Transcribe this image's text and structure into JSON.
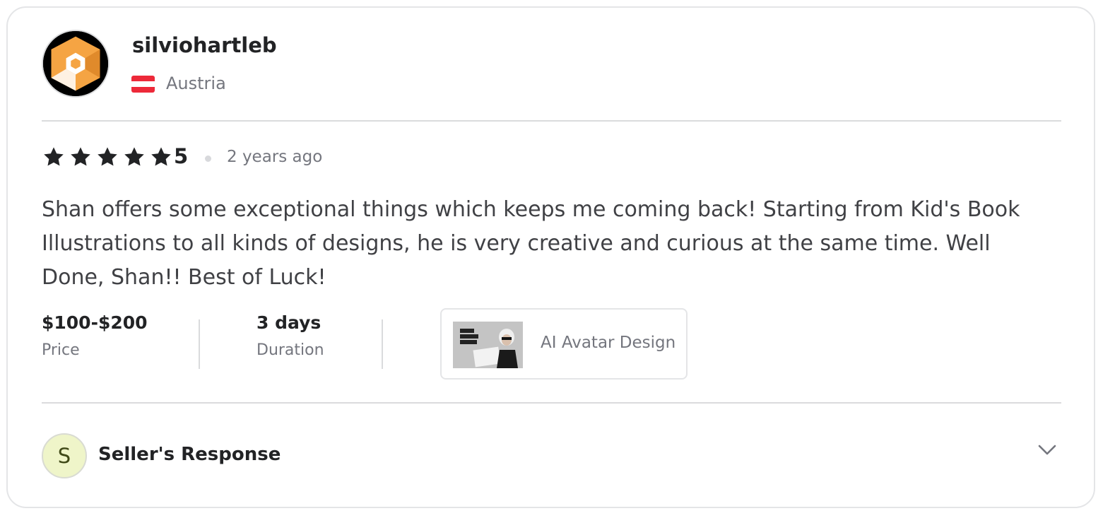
{
  "reviewer": {
    "username": "silviohartleb",
    "country": "Austria",
    "avatar_icon": "orange-hexagon-logo-icon",
    "flag_icon": "austria-flag-icon"
  },
  "review": {
    "rating": 5,
    "rating_label": "5",
    "time_ago": "2 years ago",
    "text": "Shan offers some exceptional things which keeps me coming back! Starting from Kid's Book Illustrations to all kinds of designs, he is very creative and curious at the same time. Well Done, Shan!! Best of Luck!"
  },
  "meta": {
    "price_value": "$100-$200",
    "price_label": "Price",
    "duration_value": "3 days",
    "duration_label": "Duration"
  },
  "gig": {
    "title": "AI Avatar Design"
  },
  "seller_response": {
    "initial": "S",
    "title": "Seller's Response",
    "toggle_icon": "chevron-down-icon"
  },
  "colors": {
    "star": "#222325",
    "logo_orange": "#f5a443",
    "flag_red": "#ed2939",
    "seller_avatar_bg": "#eff5c9"
  }
}
